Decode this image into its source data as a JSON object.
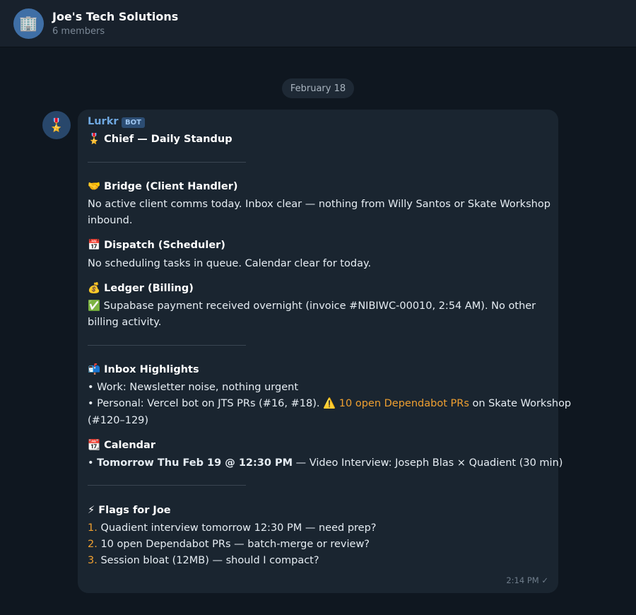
{
  "chat": {
    "group_icon": "🏢",
    "group_name": "Joe's Tech Solutions",
    "member_count": "6 members"
  },
  "date_separator": "February 18",
  "message": {
    "avatar_icon": "🎖️",
    "sender": "Lurkr",
    "badge": "BOT",
    "title_icon": "🎖️",
    "title": "Chief — Daily Standup",
    "sections": {
      "bridge": {
        "icon": "🤝",
        "title": "Bridge (Client Handler)",
        "line1": "No active client comms today. Inbox clear — nothing from Willy Santos or Skate Workshop",
        "line2": "inbound."
      },
      "dispatch": {
        "icon": "📅",
        "title": "Dispatch (Scheduler)",
        "line1": "No scheduling tasks in queue. Calendar clear for today."
      },
      "ledger": {
        "icon": "💰",
        "title": "Ledger (Billing)",
        "check_icon": "✅",
        "line1": "Supabase payment received overnight (invoice #NIBIWC-00010, 2:54 AM). No other",
        "line2": "billing activity."
      },
      "inbox": {
        "icon": "📬",
        "title": "Inbox Highlights",
        "line1": "• Work: Newsletter noise, nothing urgent",
        "line2_a": "• Personal: Vercel bot on JTS PRs (#16, #18). ",
        "warn_icon": "⚠️",
        "line2_warn": "10 open Dependabot PRs",
        "line2_b": " on Skate Workshop",
        "line3": "(#120–129)"
      },
      "calendar": {
        "icon": "📆",
        "title": "Calendar",
        "bullet": "• ",
        "bold": "Tomorrow Thu Feb 19 @ 12:30 PM",
        "rest": " — Video Interview: Joseph Blas × Quadient (30 min)"
      },
      "flags": {
        "icon": "⚡",
        "title": "Flags for Joe",
        "items": [
          {
            "num": "1.",
            "text": " Quadient interview tomorrow 12:30 PM — need prep?"
          },
          {
            "num": "2.",
            "text": " 10 open Dependabot PRs — batch-merge or review?"
          },
          {
            "num": "3.",
            "text": " Session bloat (12MB) — should I compact?"
          }
        ]
      }
    },
    "timestamp": "2:14 PM ✓"
  }
}
